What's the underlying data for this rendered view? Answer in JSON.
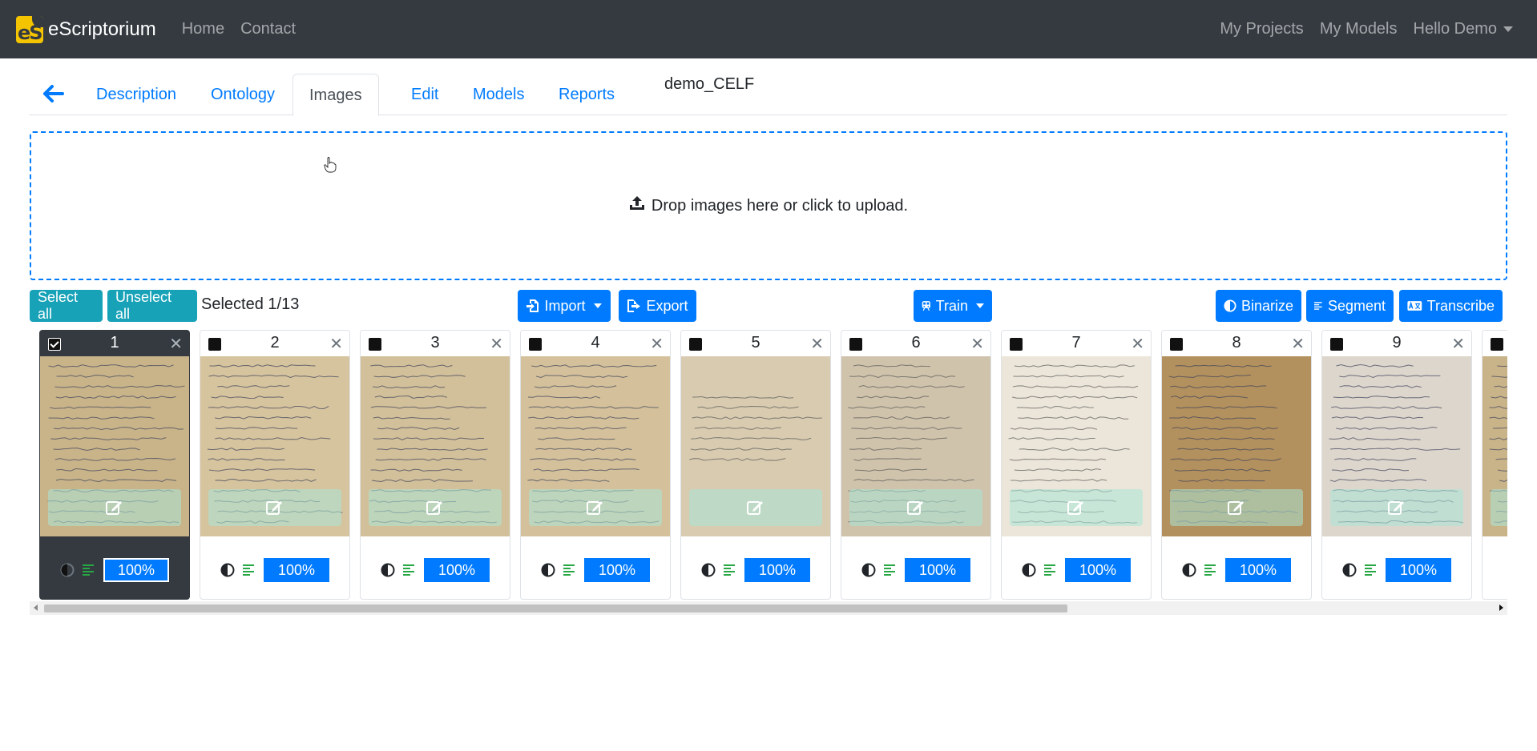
{
  "navbar": {
    "brand_logo_text": "eS",
    "brand": "eScriptorium",
    "left_links": [
      "Home",
      "Contact"
    ],
    "right_links": [
      "My Projects",
      "My Models"
    ],
    "user_menu": "Hello Demo"
  },
  "tabs": [
    "Description",
    "Ontology",
    "Images",
    "Edit",
    "Models",
    "Reports"
  ],
  "active_tab": "Images",
  "document_name": "demo_CELF",
  "dropzone": {
    "text": "Drop images here or click to upload.",
    "icon": "upload-icon"
  },
  "toolbar": {
    "select_all": "Select all",
    "unselect_all": "Unselect all",
    "selected_text": "Selected 1/13",
    "import": "Import",
    "export": "Export",
    "train": "Train",
    "binarize": "Binarize",
    "segment": "Segment",
    "transcribe": "Transcribe"
  },
  "cards": [
    {
      "num": "1",
      "pct": "100%",
      "selected": true
    },
    {
      "num": "2",
      "pct": "100%",
      "selected": false
    },
    {
      "num": "3",
      "pct": "100%",
      "selected": false
    },
    {
      "num": "4",
      "pct": "100%",
      "selected": false
    },
    {
      "num": "5",
      "pct": "100%",
      "selected": false
    },
    {
      "num": "6",
      "pct": "100%",
      "selected": false
    },
    {
      "num": "7",
      "pct": "100%",
      "selected": false
    },
    {
      "num": "8",
      "pct": "100%",
      "selected": false
    },
    {
      "num": "9",
      "pct": "100%",
      "selected": false
    }
  ],
  "colors": {
    "navbar": "#343a40",
    "primary": "#007bff",
    "teal": "#17a2b8",
    "segment_icon": "#28a745"
  }
}
